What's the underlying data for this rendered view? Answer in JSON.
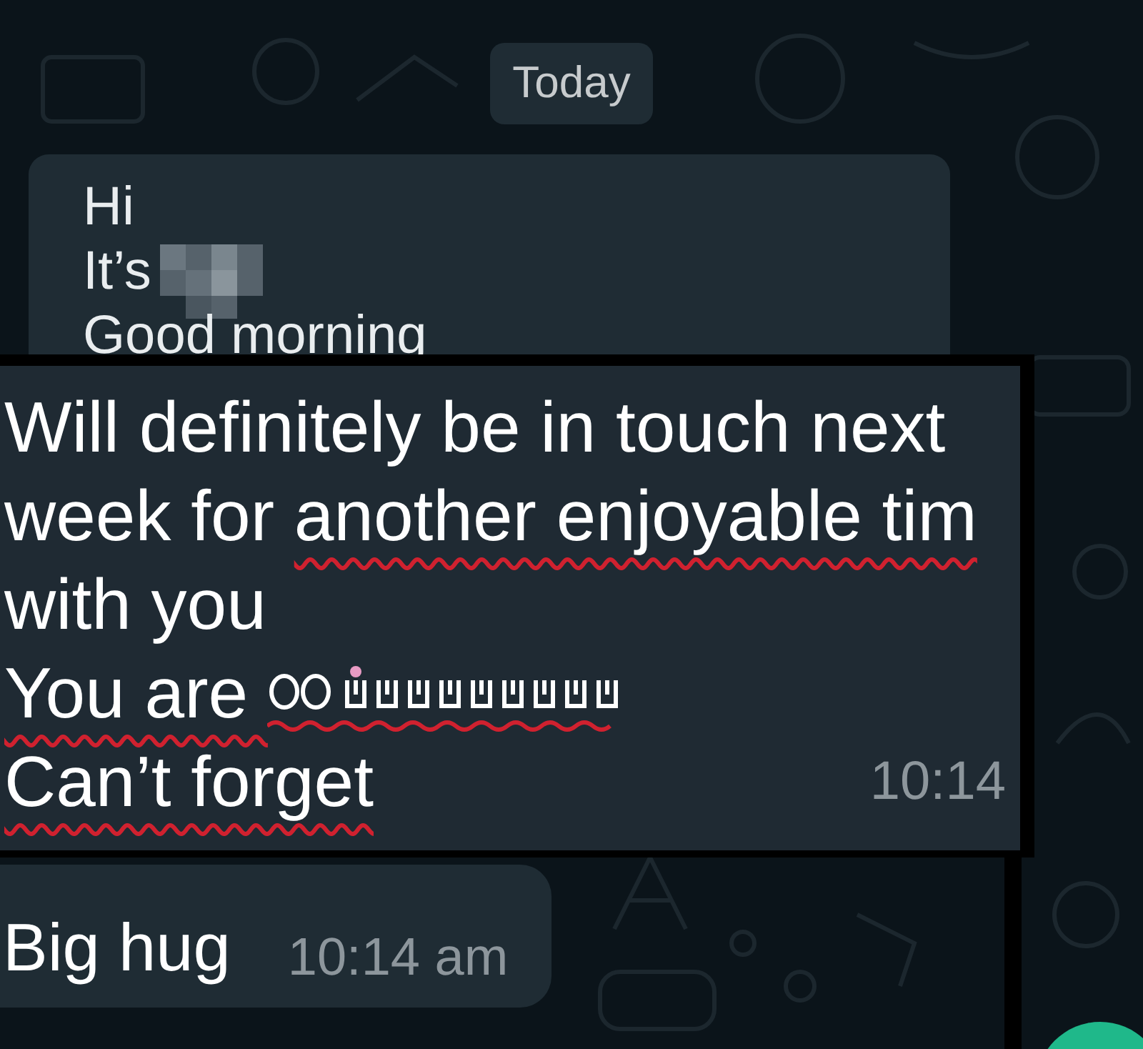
{
  "date_chip": "Today",
  "first_message": {
    "lines": [
      {
        "kind": "text",
        "text": "Hi"
      },
      {
        "kind": "name",
        "text": "It’s"
      },
      {
        "kind": "text",
        "text": "Good morning"
      }
    ]
  },
  "highlighted_message": {
    "lines": [
      {
        "segments": [
          {
            "kind": "text",
            "text": "Will definitely be in touch next",
            "underlined": false
          }
        ]
      },
      {
        "segments": [
          {
            "kind": "text",
            "text": "week for ",
            "underlined": false
          },
          {
            "kind": "text",
            "text": "another enjoyable tim",
            "underlined": true
          }
        ]
      },
      {
        "segments": [
          {
            "kind": "text",
            "text": "with you",
            "underlined": false
          }
        ]
      },
      {
        "segments": [
          {
            "kind": "text",
            "text": "You are ",
            "underlined": true
          },
          {
            "kind": "scrambled",
            "underlined": true
          }
        ]
      },
      {
        "segments": [
          {
            "kind": "text",
            "text": "Can’t forget",
            "underlined": true
          }
        ]
      }
    ],
    "time": "10:14"
  },
  "last_message": {
    "text": "Big hug",
    "time": "10:14 am"
  }
}
